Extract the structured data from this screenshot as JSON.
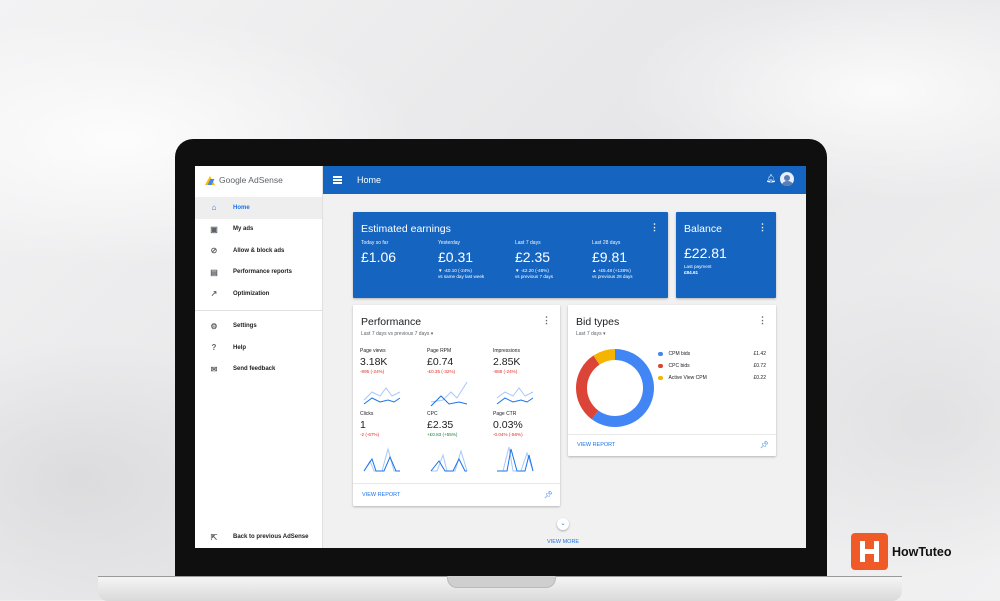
{
  "sidebar": {
    "brand": "Google AdSense",
    "items": [
      {
        "label": "Home",
        "icon": "home-icon",
        "active": true
      },
      {
        "label": "My ads",
        "icon": "ads-icon"
      },
      {
        "label": "Allow & block ads",
        "icon": "block-icon"
      },
      {
        "label": "Performance reports",
        "icon": "bar-chart-icon"
      },
      {
        "label": "Optimization",
        "icon": "trending-icon"
      },
      {
        "label": "Settings",
        "icon": "gear-icon"
      },
      {
        "label": "Help",
        "icon": "help-icon"
      },
      {
        "label": "Send feedback",
        "icon": "feedback-icon"
      }
    ],
    "back": "Back to previous AdSense"
  },
  "topbar": {
    "title": "Home"
  },
  "earnings": {
    "title": "Estimated earnings",
    "metrics": [
      {
        "label": "Today so far",
        "value": "£1.06",
        "change": "",
        "compare": ""
      },
      {
        "label": "Yesterday",
        "value": "£0.31",
        "change": "▼ -£0.10 (-24%)",
        "compare": "vs same day last week"
      },
      {
        "label": "Last 7 days",
        "value": "£2.35",
        "change": "▼ -£2.20 (-48%)",
        "compare": "vs previous 7 days"
      },
      {
        "label": "Last 28 days",
        "value": "£9.81",
        "change": "▲ +£5.48 (+138%)",
        "compare": "vs previous 28 days"
      }
    ]
  },
  "balance": {
    "title": "Balance",
    "value": "£22.81",
    "last_label": "Last payment",
    "last_value": "£84.61"
  },
  "performance": {
    "title": "Performance",
    "range": "Last 7 days vs previous 7 days",
    "metrics": [
      {
        "label": "Page views",
        "value": "3.18K",
        "change": "-895 (-24%)",
        "trend": "neg"
      },
      {
        "label": "Page RPM",
        "value": "£0.74",
        "change": "-£0.35 (-32%)",
        "trend": "neg"
      },
      {
        "label": "Impressions",
        "value": "2.85K",
        "change": "-888 (-24%)",
        "trend": "neg"
      },
      {
        "label": "Clicks",
        "value": "1",
        "change": "-2 (-67%)",
        "trend": "neg"
      },
      {
        "label": "CPC",
        "value": "£2.35",
        "change": "+£0.83 (+55%)",
        "trend": "pos"
      },
      {
        "label": "Page CTR",
        "value": "0.03%",
        "change": "-0.04% (-56%)",
        "trend": "neg"
      }
    ],
    "view_report": "VIEW REPORT"
  },
  "bid_types": {
    "title": "Bid types",
    "range": "Last 7 days",
    "items": [
      {
        "label": "CPM bids",
        "value": "£1.42",
        "color": "#4285f4"
      },
      {
        "label": "CPC bids",
        "value": "£0.72",
        "color": "#db4437"
      },
      {
        "label": "Active View CPM",
        "value": "£0.22",
        "color": "#f4b400"
      }
    ],
    "view_report": "VIEW REPORT"
  },
  "view_more": "VIEW MORE",
  "watermark": "HowTuteo",
  "chart_data": {
    "type": "pie",
    "categories": [
      "CPM bids",
      "CPC bids",
      "Active View CPM"
    ],
    "values": [
      1.42,
      0.72,
      0.22
    ]
  }
}
